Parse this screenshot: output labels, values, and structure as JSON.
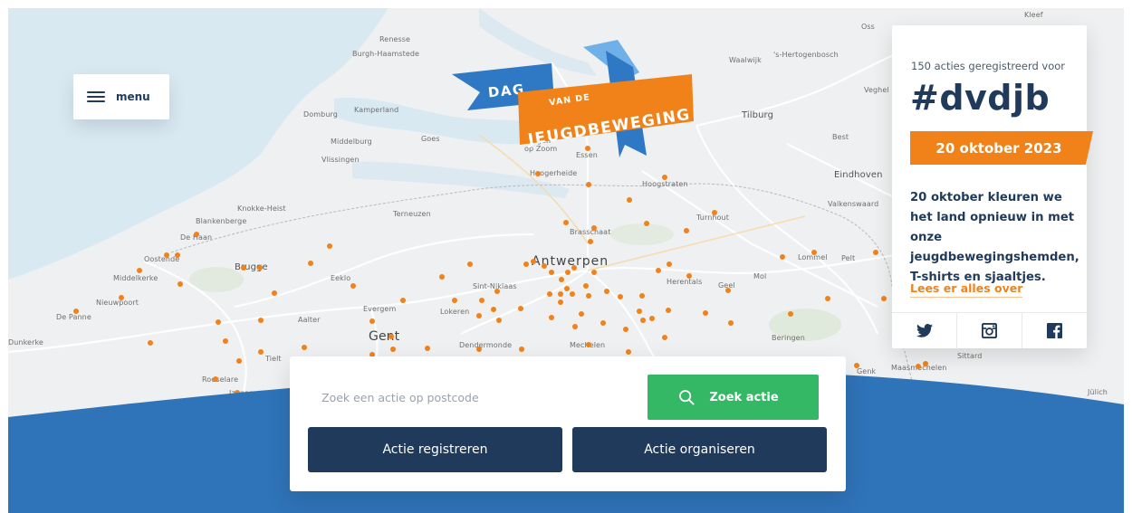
{
  "menu": {
    "label": "menu"
  },
  "logo": {
    "line1": "DAG",
    "line2": "VAN DE",
    "line3": "JEUGDBEWEGING",
    "colors": {
      "blue": "#2f78c3",
      "orange": "#f08219",
      "light_blue": "#6fb0e8"
    }
  },
  "info_card": {
    "count_text": "150 acties geregistreerd voor",
    "hashtag": "#dvdjb",
    "date": "20 oktober 2023",
    "description": "20 oktober kleuren we het land opnieuw in met onze jeugdbewegingshemden, T-shirts en sjaaltjes.",
    "more_link": "Lees er alles over",
    "social": [
      "twitter-icon",
      "instagram-icon",
      "facebook-icon"
    ]
  },
  "search": {
    "placeholder": "Zoek een actie op postcode",
    "button_label": "Zoek actie"
  },
  "actions": {
    "register": "Actie registreren",
    "organise": "Actie organiseren"
  },
  "colors": {
    "navy": "#1f3a5a",
    "orange": "#f08219",
    "green": "#34b865",
    "wave_blue": "#2f73b8"
  },
  "map_labels": [
    "Renesse",
    "Burgh-Haamstede",
    "Domburg",
    "Kamperland",
    "Goes",
    "Middelburg",
    "Vlissingen",
    "Bergen op Zoom",
    "Essen",
    "Hoogerheide",
    "Hoogstraten",
    "Tilburg",
    "Waalwijk",
    "'s-Hertogenbosch",
    "Oss",
    "Kleef",
    "Veghel",
    "Best",
    "Eindhoven",
    "Valkenswaard",
    "Turnhout",
    "Brasschaat",
    "Antwerpen",
    "Knokke-Heist",
    "Blankenberge",
    "De Haan",
    "Oostende",
    "Middelkerke",
    "Nieuwpoort",
    "De Panne",
    "Brugge",
    "Eeklo",
    "Terneuzen",
    "Evergem",
    "Aalter",
    "Gent",
    "Lokeren",
    "Sint-Niklaas",
    "Dendermonde",
    "Mechelen",
    "Herentals",
    "Geel",
    "Mol",
    "Lommel",
    "Pelt",
    "Beringen",
    "Tielt",
    "Roeselare",
    "Izegem",
    "Genk",
    "Maasmechelen",
    "Sittard",
    "Jülich",
    "Dunkerke"
  ]
}
